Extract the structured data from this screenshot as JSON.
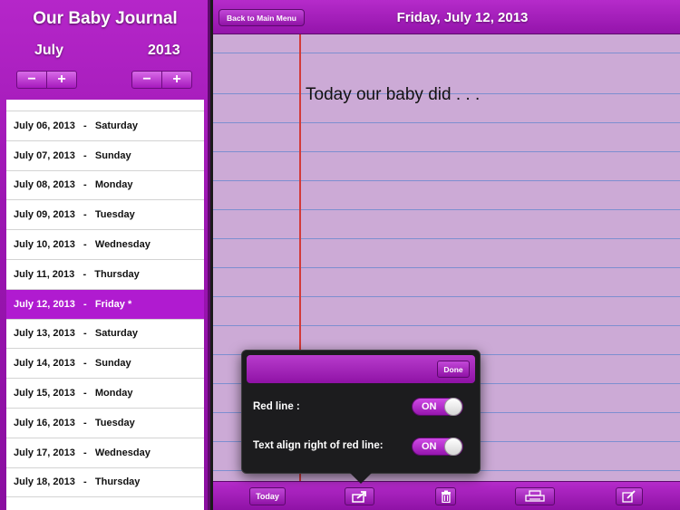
{
  "sidebar": {
    "title": "Our Baby Journal",
    "month": "July",
    "year": "2013",
    "minus": "−",
    "plus": "+",
    "dates": [
      "July 06, 2013   -   Saturday",
      "July 07, 2013   -   Sunday",
      "July 08, 2013   -   Monday",
      "July 09, 2013   -   Tuesday",
      "July 10, 2013   -   Wednesday",
      "July 11, 2013   -   Thursday",
      "July 12, 2013   -   Friday *",
      "July 13, 2013   -   Saturday",
      "July 14, 2013   -   Sunday",
      "July 15, 2013   -   Monday",
      "July 16, 2013   -   Tuesday",
      "July 17, 2013   -   Wednesday",
      "July 18, 2013   -   Thursday"
    ],
    "selected_index": 6
  },
  "header": {
    "back_label": "Back to Main Menu",
    "title": "Friday, July 12, 2013"
  },
  "entry": {
    "text": "Today our baby did . . ."
  },
  "popover": {
    "done_label": "Done",
    "red_line_label": "Red line :",
    "red_line_state": "ON",
    "align_label": "Text align right of red line:",
    "align_state": "ON"
  },
  "toolbar": {
    "today_label": "Today"
  },
  "colors": {
    "accent": "#a61ebd",
    "selected_row": "#b01bd0",
    "paper": "#ccaad6",
    "rule_line": "#7d8fd0",
    "margin_line": "#d23a3a"
  }
}
